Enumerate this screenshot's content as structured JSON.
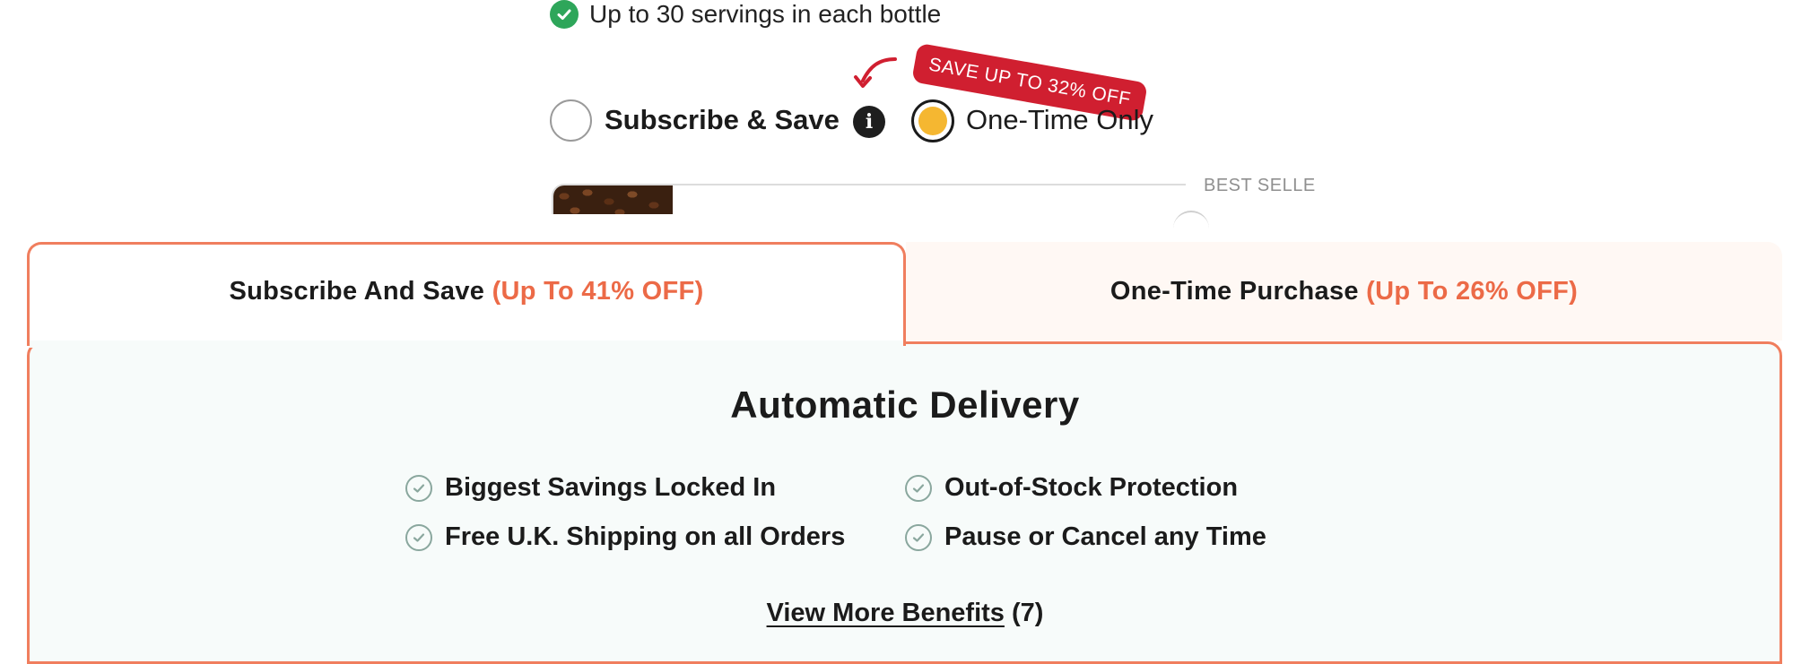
{
  "product": {
    "bullet_text": "Up to 30 servings in each bottle",
    "purchase_options": {
      "subscribe_label": "Subscribe & Save",
      "onetime_label": "One-Time Only",
      "selected": "One-Time Only",
      "badge": "SAVE UP TO 32% OFF"
    },
    "best_seller_label": "BEST SELLE"
  },
  "tabs": [
    {
      "label": "Subscribe And Save",
      "accent": "(Up To 41% OFF)",
      "active": true
    },
    {
      "label": "One-Time Purchase",
      "accent": "(Up To 26% OFF)",
      "active": false
    }
  ],
  "panel": {
    "title": "Automatic Delivery",
    "benefits": [
      "Biggest Savings Locked In",
      "Out-of-Stock Protection",
      "Free U.K. Shipping on all Orders",
      "Pause or Cancel any Time"
    ],
    "view_more_label": "View More Benefits",
    "view_more_count": "(7)"
  },
  "colors": {
    "accent": "#f07e5e",
    "badge": "#d01f30",
    "radio_selected": "#f5b731",
    "check_green": "#2ea65a"
  }
}
